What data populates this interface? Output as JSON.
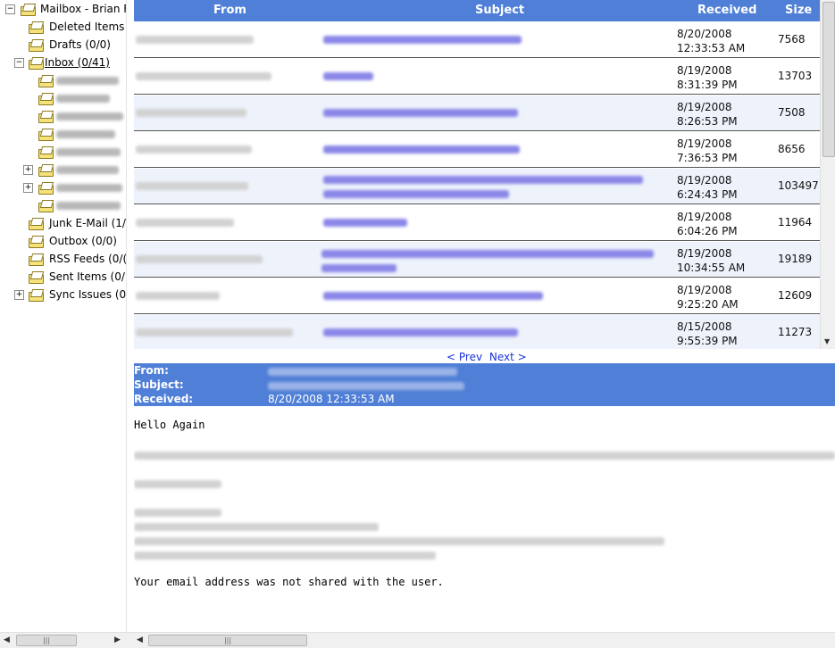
{
  "tree": {
    "mailbox_label": "Mailbox - Brian F",
    "deleted_label": "Deleted Items",
    "drafts_label": "Drafts (0/0)",
    "inbox_label": "Inbox (0/41)",
    "junk_label": "Junk E-Mail (1/",
    "outbox_label": "Outbox (0/0)",
    "rss_label": "RSS Feeds (0/(",
    "sent_label": "Sent Items (0/",
    "sync_label": "Sync Issues (0",
    "expander_minus": "−",
    "expander_plus": "+"
  },
  "list": {
    "headers": {
      "from": "From",
      "subject": "Subject",
      "received": "Received",
      "size": "Size"
    },
    "rows": [
      {
        "date": "8/20/2008",
        "time": "12:33:53 AM",
        "size": "7568"
      },
      {
        "date": "8/19/2008",
        "time": "8:31:39 PM",
        "size": "13703"
      },
      {
        "date": "8/19/2008",
        "time": "8:26:53 PM",
        "size": "7508"
      },
      {
        "date": "8/19/2008",
        "time": "7:36:53 PM",
        "size": "8656"
      },
      {
        "date": "8/19/2008",
        "time": "6:24:43 PM",
        "size": "103497"
      },
      {
        "date": "8/19/2008",
        "time": "6:04:26 PM",
        "size": "11964"
      },
      {
        "date": "8/19/2008",
        "time": "10:34:55 AM",
        "size": "19189"
      },
      {
        "date": "8/19/2008",
        "time": "9:25:20 AM",
        "size": "12609"
      },
      {
        "date": "8/15/2008",
        "time": "9:55:39 PM",
        "size": "11273"
      }
    ]
  },
  "pager": {
    "prev": "< Prev",
    "next": "Next >"
  },
  "preview": {
    "from_label": "From:",
    "subject_label": "Subject:",
    "received_label": "Received:",
    "received_value": "8/20/2008 12:33:53 AM"
  },
  "body": {
    "greeting": "Hello Again",
    "footer": "Your email address was not shared with the user."
  },
  "colors": {
    "header_blue": "#4f7fd6",
    "link_blue": "#1a33d9",
    "row_alt": "#eef2fb"
  }
}
